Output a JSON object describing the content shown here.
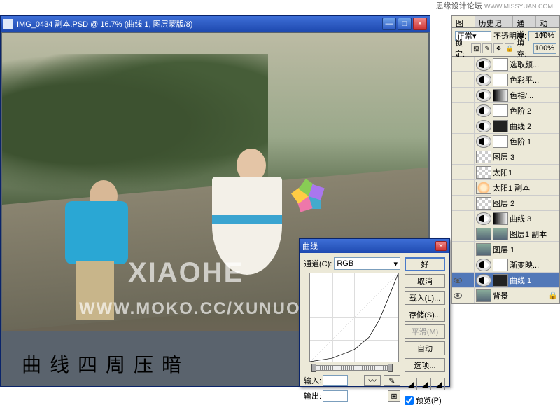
{
  "header": {
    "forum": "思缘设计论坛",
    "url": "WWW.MISSYUAN.COM"
  },
  "doc": {
    "title": "IMG_0434 副本.PSD @ 16.7% (曲线 1, 图层蒙版/8)",
    "caption": "曲线四周压暗",
    "watermark1": "XIAOHE",
    "watermark2": "WWW.MOKO.CC/XUNUO"
  },
  "curves": {
    "title": "曲线",
    "channel_label": "通道(C):",
    "channel_value": "RGB",
    "input_label": "输入:",
    "output_label": "输出:",
    "buttons": {
      "ok": "好",
      "cancel": "取消",
      "load": "载入(L)...",
      "save": "存储(S)...",
      "smooth": "平滑(M)",
      "auto": "自动",
      "options": "选项..."
    },
    "preview_label": "预览(P)"
  },
  "panels": {
    "tabs": [
      "图层",
      "历史记录",
      "通道",
      "动作"
    ],
    "blend_label": "正常",
    "opacity_label": "不透明度:",
    "opacity_value": "100%",
    "lock_label": "锁定:",
    "fill_label": "填充:",
    "fill_value": "100%"
  },
  "layers": [
    {
      "name": "选取颜...",
      "thumbs": [
        "adj",
        "mask"
      ],
      "vis": false
    },
    {
      "name": "色彩平...",
      "thumbs": [
        "adj",
        "mask"
      ],
      "vis": false
    },
    {
      "name": "色相/...",
      "thumbs": [
        "adj",
        "grad"
      ],
      "vis": false
    },
    {
      "name": "色阶 2",
      "thumbs": [
        "adj",
        "mask"
      ],
      "vis": false
    },
    {
      "name": "曲线 2",
      "thumbs": [
        "adj",
        "dark"
      ],
      "vis": false
    },
    {
      "name": "色阶 1",
      "thumbs": [
        "adj",
        "mask"
      ],
      "vis": false
    },
    {
      "name": "图层 3",
      "thumbs": [
        "checker"
      ],
      "vis": false
    },
    {
      "name": "太阳1",
      "thumbs": [
        "checker"
      ],
      "vis": false
    },
    {
      "name": "太阳1 副本",
      "thumbs": [
        "sun"
      ],
      "vis": false
    },
    {
      "name": "图层 2",
      "thumbs": [
        "checker"
      ],
      "vis": false
    },
    {
      "name": "曲线 3",
      "thumbs": [
        "adj",
        "grad"
      ],
      "vis": false
    },
    {
      "name": "图层1 副本",
      "thumbs": [
        "img",
        "img"
      ],
      "vis": false
    },
    {
      "name": "图层 1",
      "thumbs": [
        "img"
      ],
      "vis": false
    },
    {
      "name": "渐变映...",
      "thumbs": [
        "adj",
        "mask"
      ],
      "vis": false
    },
    {
      "name": "曲线 1",
      "thumbs": [
        "adj",
        "dark"
      ],
      "vis": true,
      "active": true
    },
    {
      "name": "背景",
      "thumbs": [
        "img"
      ],
      "vis": true,
      "locked": true
    }
  ],
  "chart_data": {
    "type": "line",
    "title": "曲线",
    "xlabel": "输入",
    "ylabel": "输出",
    "xlim": [
      0,
      255
    ],
    "ylim": [
      0,
      255
    ],
    "series": [
      {
        "name": "RGB",
        "x": [
          0,
          64,
          128,
          170,
          200,
          225,
          255
        ],
        "y": [
          0,
          10,
          35,
          70,
          120,
          180,
          255
        ]
      }
    ]
  }
}
